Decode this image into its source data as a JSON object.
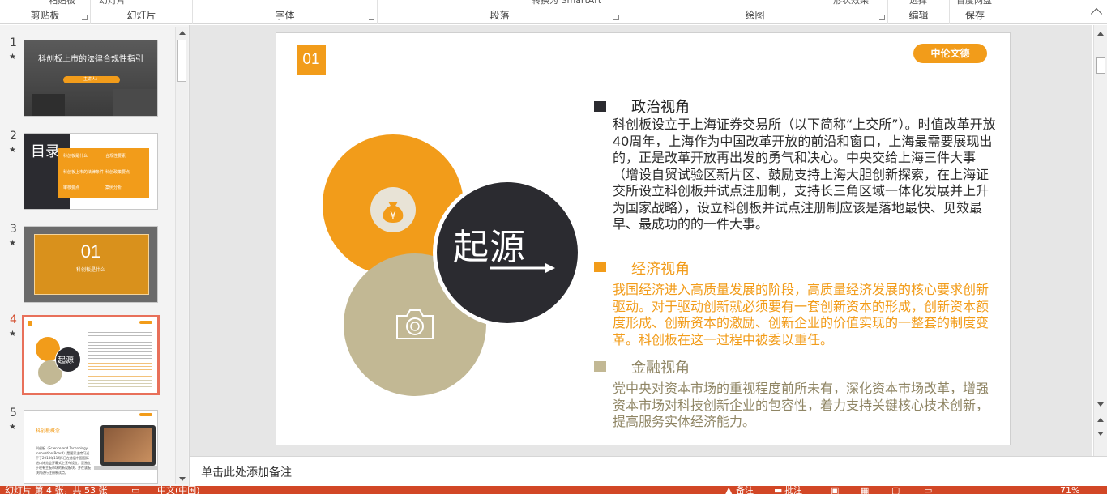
{
  "ribbon": {
    "groups": [
      "剪贴板",
      "幻灯片",
      "字体",
      "段落",
      "绘图",
      "编辑",
      "保存"
    ],
    "partial_top_text": [
      "粘贴板",
      "幻灯片",
      "转换为 SmartArt",
      "形状效果",
      "选择",
      "百度网盘"
    ]
  },
  "thumbnails": [
    {
      "num": "1",
      "title": "科创板上市的法律合规性指引",
      "sub": "主讲人："
    },
    {
      "num": "2",
      "title": "目录",
      "items": [
        "科创板是什么",
        "合规性要素",
        "科创板上市的法律条件",
        "科创政策要点",
        "审核要点",
        "案例分析"
      ]
    },
    {
      "num": "3",
      "title": "01",
      "sub": "科创板是什么"
    },
    {
      "num": "4",
      "title": "起源"
    },
    {
      "num": "5",
      "title": "科创板概念",
      "body": "科创板（Science and Technology Innovation Board）是国家主席习近平于2018年11月5日在首届中国国际进口博览会开幕式上宣布设立，是独立于现有主板市场的新设板块，并在该板块内进行注册制试点。"
    }
  ],
  "slide": {
    "number": "01",
    "badge": "中伦文德",
    "circle_title": "起源",
    "sections": [
      {
        "heading": "政治视角",
        "body": "科创板设立于上海证券交易所（以下简称“上交所”）。时值改革开放40周年，上海作为中国改革开放的前沿和窗口，上海最需要展现出的，正是改革开放再出发的勇气和决心。中央交给上海三件大事（增设自贸试验区新片区、鼓励支持上海大胆创新探索，在上海证交所设立科创板并试点注册制，支持长三角区域一体化发展并上升为国家战略），设立科创板并试点注册制应该是落地最快、见效最早、最成功的的一件大事。"
      },
      {
        "heading": "经济视角",
        "body": "我国经济进入高质量发展的阶段，高质量经济发展的核心要求创新驱动。对于驱动创新就必须要有一套创新资本的形成，创新资本额度形成、创新资本的激励、创新企业的价值实现的一整套的制度变革。科创板在这一过程中被委以重任。"
      },
      {
        "heading": "金融视角",
        "body": "党中央对资本市场的重视程度前所未有，深化资本市场改革，增强资本市场对科技创新企业的包容性，着力支持关键核心技术创新，提高服务实体经济能力。"
      }
    ]
  },
  "notes": {
    "placeholder": "单击此处添加备注"
  },
  "status": {
    "slide_info": "幻灯片 第 4 张，共 53 张",
    "language": "中文(中国)",
    "notes_btn": "备注",
    "comments_btn": "批注",
    "zoom": "71%"
  },
  "colors": {
    "orange": "#f29c1a",
    "dark": "#2b2b30",
    "khaki": "#c2b894",
    "accent_status": "#d24726"
  }
}
